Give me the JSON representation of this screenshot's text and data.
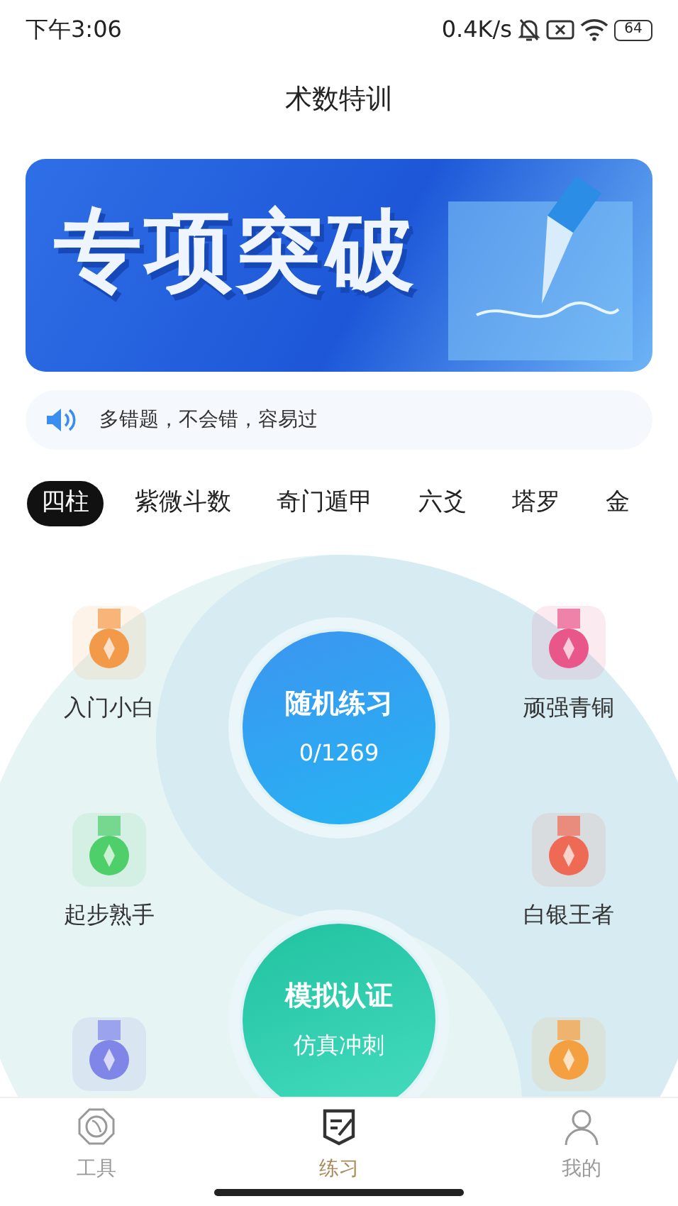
{
  "status_bar": {
    "time": "下午3:06",
    "net_speed": "0.4K/s",
    "battery": "64"
  },
  "title": "术数特训",
  "banner": {
    "title": "专项突破"
  },
  "notice": {
    "text": "多错题，不会错，容易过"
  },
  "categories": [
    {
      "label": "四柱",
      "selected": true
    },
    {
      "label": "紫微斗数",
      "selected": false
    },
    {
      "label": "奇门遁甲",
      "selected": false
    },
    {
      "label": "六爻",
      "selected": false
    },
    {
      "label": "塔罗",
      "selected": false
    },
    {
      "label": "金",
      "selected": false
    }
  ],
  "practice": {
    "random": {
      "title": "随机练习",
      "progress": "0/1269"
    },
    "mock": {
      "title": "模拟认证",
      "subtitle": "仿真冲刺"
    }
  },
  "medals_left": [
    {
      "label": "入门小白",
      "color": "#f39a4a"
    },
    {
      "label": "起步熟手",
      "color": "#4fcf6a"
    },
    {
      "color": "#7f86e8"
    }
  ],
  "medals_right": [
    {
      "label": "顽强青铜",
      "color": "#e9568a"
    },
    {
      "label": "白银王者",
      "color": "#ef6a55"
    },
    {
      "color": "#f5a040"
    }
  ],
  "bottom_nav": [
    {
      "label": "工具",
      "kind": "tools",
      "selected": false
    },
    {
      "label": "练习",
      "kind": "practice",
      "selected": true
    },
    {
      "label": "我的",
      "kind": "profile",
      "selected": false
    }
  ]
}
